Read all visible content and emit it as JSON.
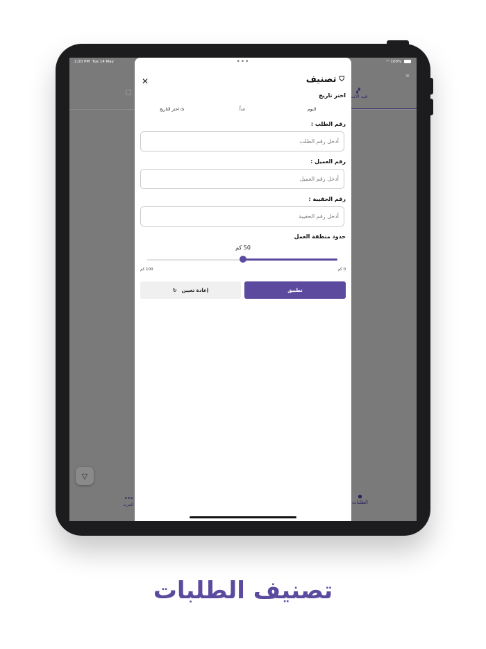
{
  "status_bar": {
    "time": "2:20 PM",
    "date": "Tue 14 May",
    "battery": "100%"
  },
  "background_app": {
    "tab_active": "قيد الانت",
    "more_label": "المزيد",
    "orders_label": "الطلبات"
  },
  "sheet": {
    "title": "تصنيف",
    "choose_date": "اختر تاريخ",
    "date_options": [
      "اليوم",
      "غداً",
      "اختر التاريخ"
    ],
    "order_number": {
      "label": "رقم الطلب :",
      "placeholder": "أدخل رقم الطلب"
    },
    "client_number": {
      "label": "رقم العميل :",
      "placeholder": "أدخل رقم العميل"
    },
    "bag_number": {
      "label": "رقم الحقيبة :",
      "placeholder": "أدخل رقم الحقيبة"
    },
    "work_area": {
      "label": "حدود منطقة العمل",
      "value_text": "50 كم",
      "value": 50,
      "min_label": "0 كم",
      "max_label": "100 كم",
      "min": 0,
      "max": 100
    },
    "apply_label": "تطبيق",
    "reset_label": "إعادة تعيين"
  },
  "caption": "تصنيف الطلبات",
  "colors": {
    "accent": "#5b4a9e",
    "overlay": "#7a7a7a"
  }
}
